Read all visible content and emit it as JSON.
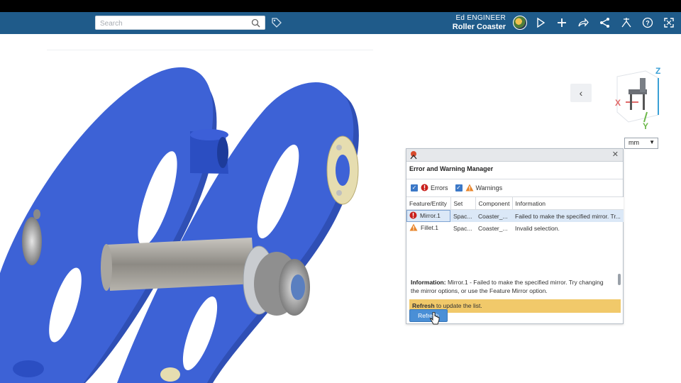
{
  "topbar": {
    "search_placeholder": "Search",
    "user_name": "Ed ENGINEER",
    "app_name": "Roller Coaster",
    "icons": [
      "search-icon",
      "tag-icon",
      "avatar",
      "play-icon",
      "plus-icon",
      "share-arrow-icon",
      "share-network-icon",
      "feature-icon",
      "help-icon",
      "fullscreen-icon"
    ]
  },
  "viewport": {
    "units": "mm",
    "compass": {
      "z_label": "Z",
      "x_label": "X",
      "y_label": "Y"
    }
  },
  "panel": {
    "title": "Error and Warning Manager",
    "filters": {
      "errors_label": "Errors",
      "warnings_label": "Warnings"
    },
    "columns": [
      "Feature/Entity",
      "Set",
      "Component",
      "Information"
    ],
    "rows": [
      {
        "type": "error",
        "feature": "Mirror.1",
        "set": "Spac...",
        "component": "Coaster_...",
        "info": "Failed to make the specified mirror. Tr..."
      },
      {
        "type": "warning",
        "feature": "Fillet.1",
        "set": "Spac...",
        "component": "Coaster_...",
        "info": "Invalid selection."
      }
    ],
    "info_label": "Information:",
    "info_text": " Mirror.1 - Failed to make the specified mirror. Try changing the mirror options, or use the Feature Mirror option.",
    "notice_bold": "Refresh",
    "notice_text": " to update the list.",
    "refresh_button": "Refresh"
  },
  "colors": {
    "topbar": "#1f5b8a",
    "part_blue": "#3a5fd0",
    "notice": "#f1c96a",
    "button": "#4a8fd6"
  }
}
